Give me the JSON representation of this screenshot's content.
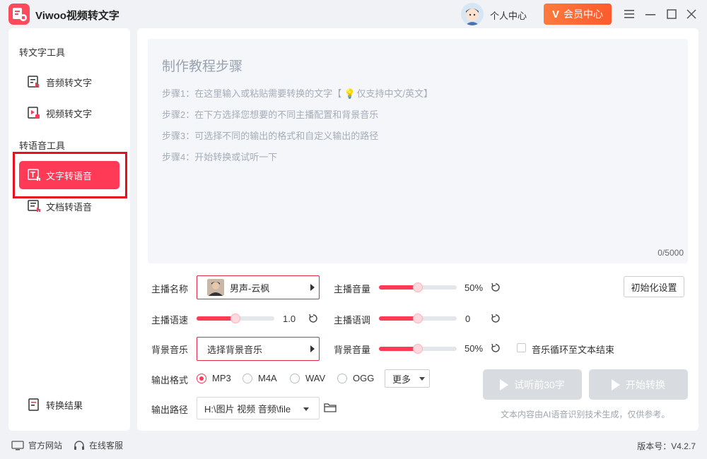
{
  "app": {
    "title": "Viwoo视频转文字"
  },
  "header": {
    "user_center": "个人中心",
    "vip_label": "会员中心"
  },
  "sidebar": {
    "section1": "转文字工具",
    "section2": "转语音工具",
    "items": [
      {
        "label": "音频转文字"
      },
      {
        "label": "视频转文字"
      },
      {
        "label": "文字转语音"
      },
      {
        "label": "文档转语音"
      }
    ],
    "result_label": "转换结果"
  },
  "editor": {
    "title": "制作教程步骤",
    "steps": [
      "步骤1：在这里输入或粘贴需要转换的文字【",
      "步骤2：在下方选择您想要的不同主播配置和背景音乐",
      "步骤3：可选择不同的输出的格式和自定义输出的路径",
      "步骤4：开始转换或试听一下"
    ],
    "step1_suffix": "仅支持中文/英文】",
    "counter": "0/5000"
  },
  "settings": {
    "anchor_name_label": "主播名称",
    "anchor_name_value": "男声-云枫",
    "anchor_volume_label": "主播音量",
    "anchor_volume_value": "50%",
    "anchor_speed_label": "主播语速",
    "anchor_speed_value": "1.0",
    "anchor_tone_label": "主播语调",
    "anchor_tone_value": "0",
    "bgm_label": "背景音乐",
    "bgm_value": "选择背景音乐",
    "bgm_volume_label": "背景音量",
    "bgm_volume_value": "50%",
    "loop_label": "音乐循环至文本结束",
    "init_button": "初始化设置",
    "format_label": "输出格式",
    "formats": [
      "MP3",
      "M4A",
      "WAV",
      "OGG"
    ],
    "selected_format": "MP3",
    "more_label": "更多",
    "path_label": "输出路径",
    "path_value": "H:\\图片 视频 音频\\file"
  },
  "slider_levels": {
    "anchor_volume": 0.5,
    "anchor_speed": 0.5,
    "anchor_tone": 0.5,
    "bgm_volume": 0.5
  },
  "actions": {
    "preview_button": "试听前30字",
    "start_button": "开始转换",
    "disclaimer": "文本内容由AI语音识别技术生成，仅供参考。"
  },
  "footer": {
    "official_site": "官方网站",
    "online_service": "在线客服",
    "version": "版本号：V4.2.7"
  },
  "colors": {
    "accent": "#ff3a57",
    "vip": "#ff6a35",
    "highlight": "#e8101e"
  }
}
